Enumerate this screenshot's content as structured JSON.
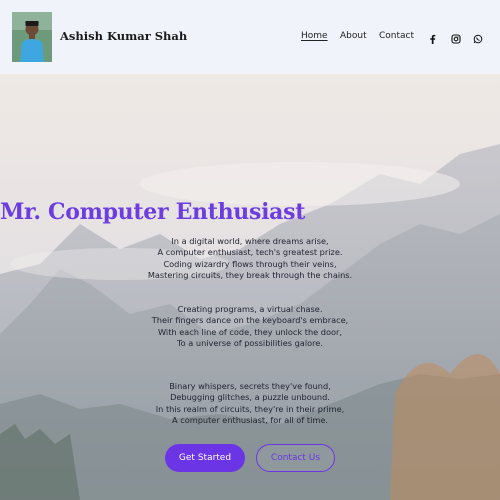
{
  "header": {
    "site_name": "Ashish Kumar Shah",
    "nav": [
      {
        "label": "Home"
      },
      {
        "label": "About"
      },
      {
        "label": "Contact"
      }
    ],
    "social_icons": [
      "facebook-icon",
      "instagram-icon",
      "whatsapp-icon"
    ]
  },
  "hero": {
    "title": "Mr. Computer Enthusiast",
    "stanzas": [
      [
        "In a digital world, where dreams arise,",
        "A computer enthusiast, tech's greatest prize.",
        "Coding wizardry flows through their veins,",
        "Mastering circuits, they break through the chains."
      ],
      [
        "Creating programs, a virtual chase.",
        "Their fingers dance on the keyboard's embrace,",
        "With each line of code, they unlock the door,",
        "To a universe of possibilities galore."
      ],
      [
        "Binary whispers, secrets they've found,",
        "Debugging glitches, a puzzle unbound.",
        "In this realm of circuits, they're in their prime,",
        "A computer enthusiast, for all of time."
      ]
    ],
    "primary_button": "Get Started",
    "secondary_button": "Contact Us"
  },
  "colors": {
    "accent": "#6b35e6",
    "title": "#6c3de0",
    "header_bg": "#f1f3fb"
  }
}
